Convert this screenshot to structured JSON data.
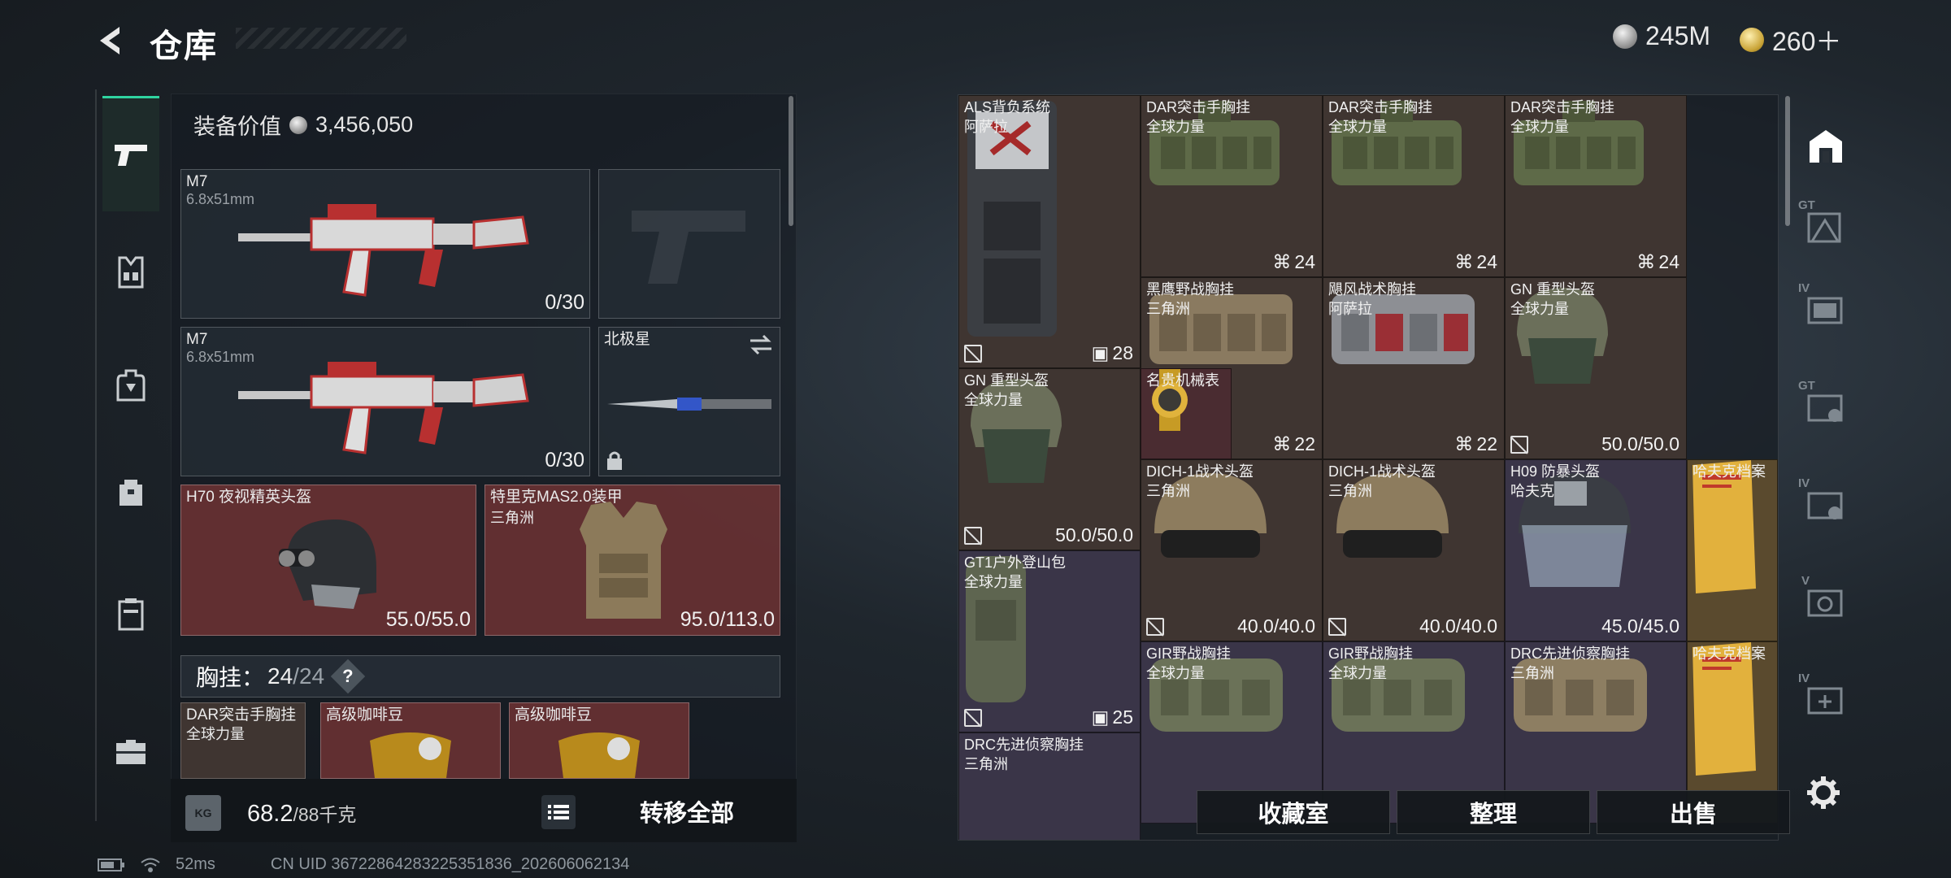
{
  "header": {
    "title": "仓库",
    "currencies": [
      {
        "icon": "silver-coin-icon",
        "value": "245M"
      },
      {
        "icon": "gold-coin-icon",
        "value": "260＋"
      }
    ]
  },
  "left_nav": {
    "items": [
      {
        "icon": "pistol-icon",
        "active": true
      },
      {
        "icon": "chest-rig-icon",
        "active": false
      },
      {
        "icon": "backpack-icon",
        "active": false
      },
      {
        "icon": "bag-icon",
        "active": false
      },
      {
        "icon": "case-icon",
        "active": false
      },
      {
        "icon": "toolbox-icon",
        "active": false
      }
    ]
  },
  "loadout": {
    "equip_value_label": "装备价值",
    "equip_value": "3,456,050",
    "weapons": [
      {
        "name": "M7",
        "caliber": "6.8x51mm",
        "ammo": "0/30"
      },
      {
        "name": "M7",
        "caliber": "6.8x51mm",
        "ammo": "0/30"
      }
    ],
    "pistol_slot": {
      "name": ""
    },
    "melee": {
      "name": "北极星"
    },
    "helmet": {
      "name": "H70 夜视精英头盔",
      "durability": "55.0/55.0"
    },
    "armor": {
      "name": "特里克MAS2.0装甲",
      "origin": "三角洲",
      "durability": "95.0/113.0"
    },
    "chest_rig": {
      "label": "胸挂：",
      "current": "24",
      "max": "/24",
      "help": "?"
    },
    "rig_items": [
      {
        "name": "DAR突击手胸挂",
        "origin": "全球力量"
      },
      {
        "name": "高级咖啡豆"
      },
      {
        "name": "高级咖啡豆"
      }
    ],
    "weight_current": "68.2",
    "weight_max": "/88千克",
    "weight_icon_text": "KG",
    "transfer_all": "转移全部"
  },
  "status": {
    "ping": "52ms",
    "uid": "CN UID 36722864283225351836_202606062134"
  },
  "stash": {
    "items": [
      {
        "name": "ALS背负系统",
        "origin": "阿萨拉",
        "count": "28",
        "bg": "brown"
      },
      {
        "name": "DAR突击手胸挂",
        "origin": "全球力量",
        "count": "24",
        "bg": "brown"
      },
      {
        "name": "DAR突击手胸挂",
        "origin": "全球力量",
        "count": "24",
        "bg": "brown"
      },
      {
        "name": "DAR突击手胸挂",
        "origin": "全球力量",
        "count": "24",
        "bg": "brown"
      },
      {
        "name": "黑鹰野战胸挂",
        "origin": "三角洲",
        "count": "22",
        "bg": "brown"
      },
      {
        "name": "飓风战术胸挂",
        "origin": "阿萨拉",
        "count": "22",
        "bg": "brown"
      },
      {
        "name": "GN 重型头盔",
        "origin": "全球力量",
        "count": "50.0/50.0",
        "bg": "brown"
      },
      {
        "name": "GN 重型头盔",
        "origin": "全球力量",
        "count": "50.0/50.0",
        "bg": "brown"
      },
      {
        "name": "名贵机械表",
        "origin": "",
        "count": "",
        "bg": "red"
      },
      {
        "name": "DICH-1战术头盔",
        "origin": "三角洲",
        "count": "40.0/40.0",
        "bg": "brown"
      },
      {
        "name": "DICH-1战术头盔",
        "origin": "三角洲",
        "count": "40.0/40.0",
        "bg": "brown"
      },
      {
        "name": "H09 防暴头盔",
        "origin": "哈夫克",
        "count": "45.0/45.0",
        "bg": "purple"
      },
      {
        "name": "哈夫克档案",
        "origin": "",
        "count": "",
        "bg": "gold"
      },
      {
        "name": "GT1户外登山包",
        "origin": "全球力量",
        "count": "25",
        "bg": "purple"
      },
      {
        "name": "GIR野战胸挂",
        "origin": "全球力量",
        "count": "",
        "bg": "purple"
      },
      {
        "name": "GIR野战胸挂",
        "origin": "全球力量",
        "count": "",
        "bg": "purple"
      },
      {
        "name": "DRC先进侦察胸挂",
        "origin": "三角洲",
        "count": "",
        "bg": "purple"
      },
      {
        "name": "哈夫克档案",
        "origin": "",
        "count": "",
        "bg": "gold"
      },
      {
        "name": "DRC先进侦察胸挂",
        "origin": "三角洲",
        "count": "",
        "bg": "purple"
      }
    ],
    "actions": {
      "collection": "收藏室",
      "sort": "整理",
      "sell": "出售"
    }
  },
  "right_tabs": [
    {
      "icon": "stash-home-icon",
      "label": ""
    },
    {
      "icon": "stash-tab-icon",
      "label": "GT"
    },
    {
      "icon": "stash-tab-icon",
      "label": "IV"
    },
    {
      "icon": "stash-tab-icon",
      "label": "GT"
    },
    {
      "icon": "stash-tab-icon",
      "label": "IV"
    },
    {
      "icon": "stash-tab-icon",
      "label": "V"
    },
    {
      "icon": "stash-tab-add-icon",
      "label": "IV"
    }
  ]
}
